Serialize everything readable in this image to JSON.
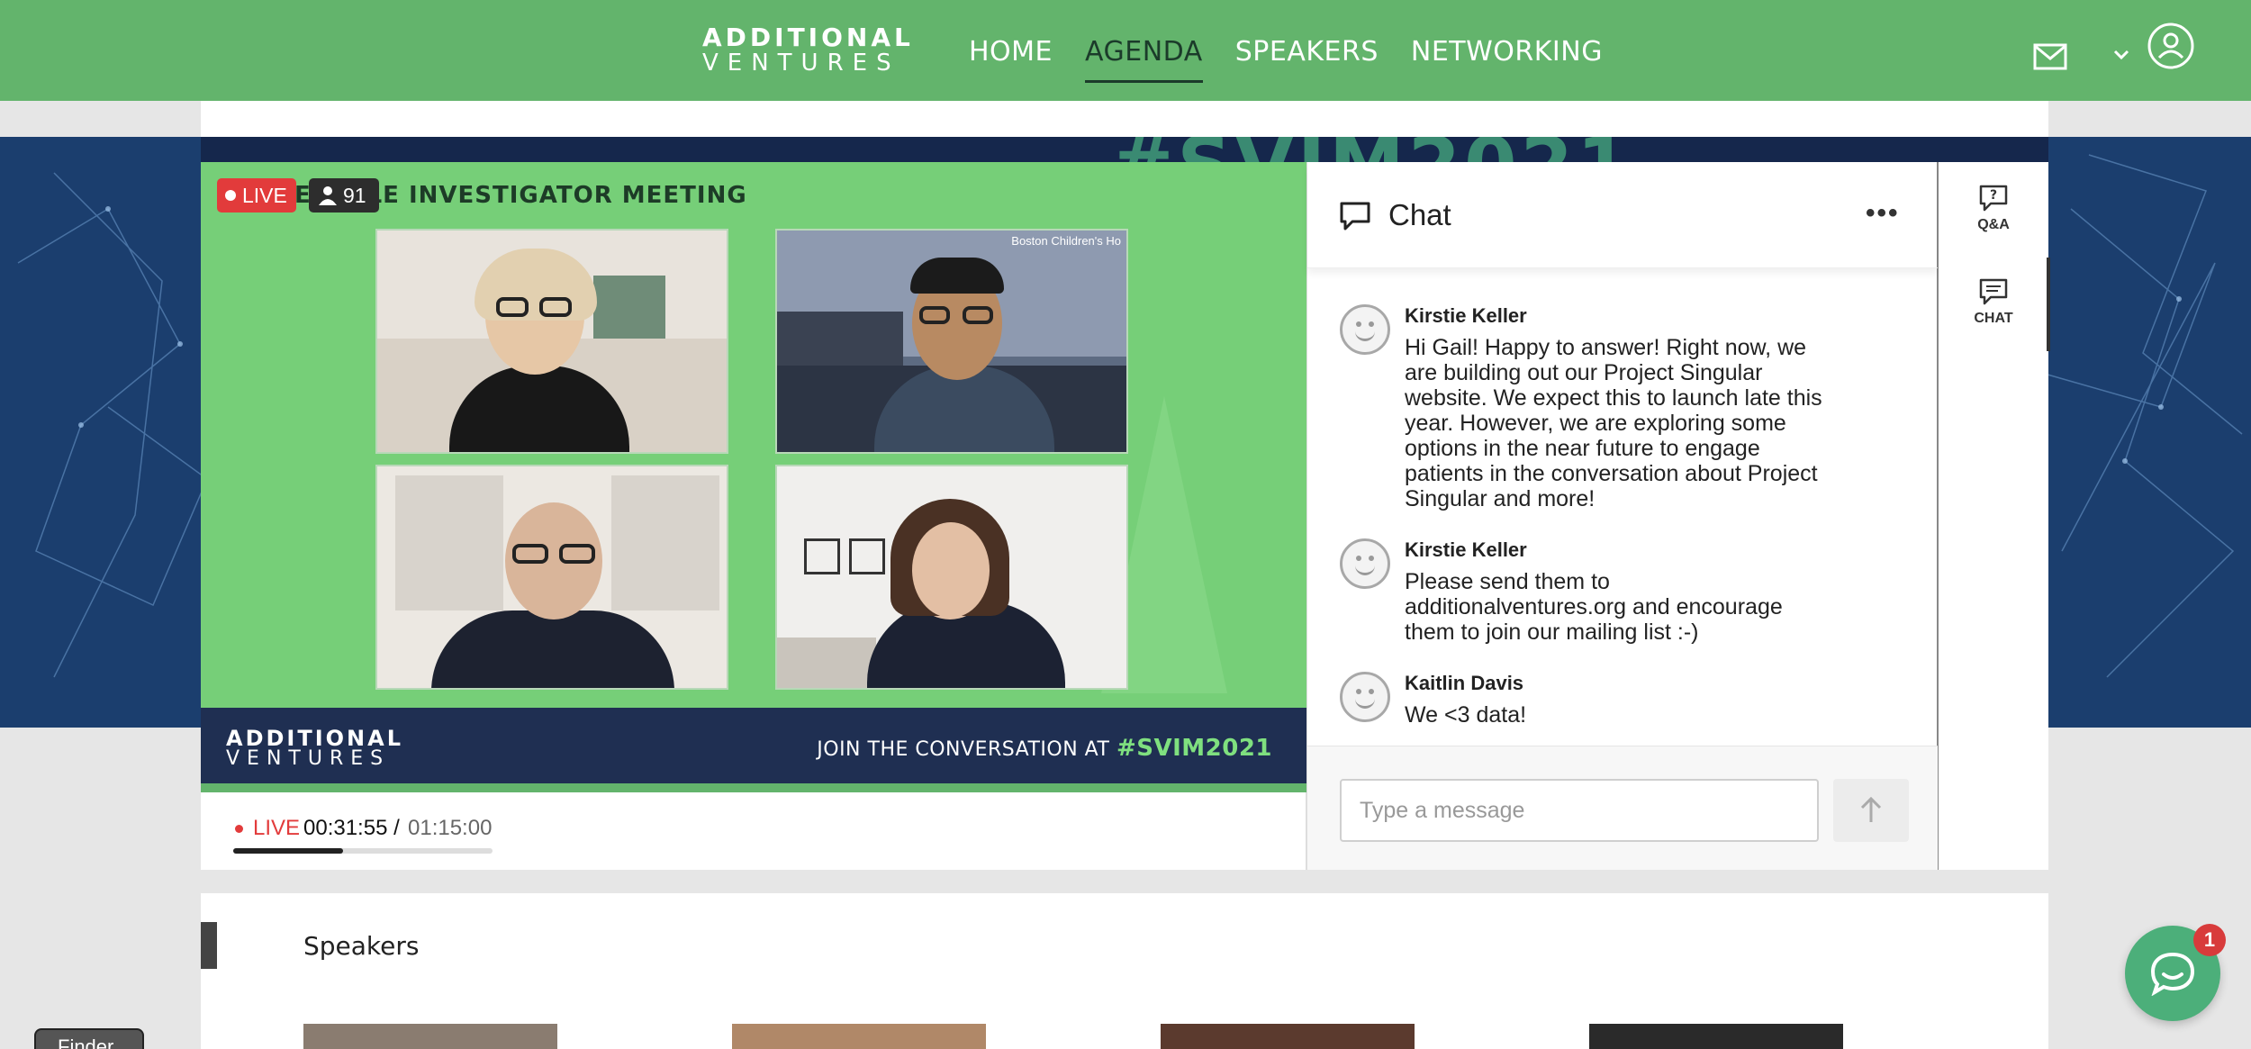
{
  "header": {
    "logo_line1": "ADDITIONAL",
    "logo_line2": "VENTURES",
    "nav": [
      "HOME",
      "AGENDA",
      "SPEAKERS",
      "NETWORKING"
    ],
    "active_nav": "AGENDA",
    "icons": [
      "mail-icon",
      "chevron-down-icon",
      "user-icon"
    ]
  },
  "banner": {
    "hashtag": "#SVIM2021"
  },
  "video": {
    "live_label": "LIVE",
    "viewer_count": "91",
    "title": "E RICLE INVESTIGATOR MEETING",
    "tile_label": "Boston Children's Ho",
    "footer_logo_line1": "ADDITIONAL",
    "footer_logo_line2": "VENTURES",
    "footer_join": "JOIN THE CONVERSATION AT",
    "footer_hashtag": "#SVIM2021"
  },
  "player": {
    "live_label": "LIVE",
    "current_time": "00:31:55",
    "separator": " /",
    "total_time": "01:15:00",
    "progress_fraction": 0.425
  },
  "chat": {
    "title": "Chat",
    "more_label": "•••",
    "messages": [
      {
        "name": "Kirstie Keller",
        "text": "Hi Gail! Happy to answer! Right now, we are building out our Project Singular website. We expect this to launch late this year. However, we are exploring some options in the near future to engage patients in the conversation about Project Singular and more!"
      },
      {
        "name": "Kirstie Keller",
        "text": "Please send them to additionalventures.org and encourage them to join our mailing list :-)"
      },
      {
        "name": "Kaitlin Davis",
        "text": "We <3 data!"
      }
    ],
    "input_placeholder": "Type a message"
  },
  "side_rail": {
    "qa_label": "Q&A",
    "chat_label": "CHAT"
  },
  "speakers": {
    "title": "Speakers"
  },
  "finder_label": "Finder",
  "help_badge": "1",
  "colors": {
    "header_green": "#63b46c",
    "live_red": "#e23b3b",
    "video_green": "#76cf78",
    "banner_navy": "#1b3e6e"
  }
}
